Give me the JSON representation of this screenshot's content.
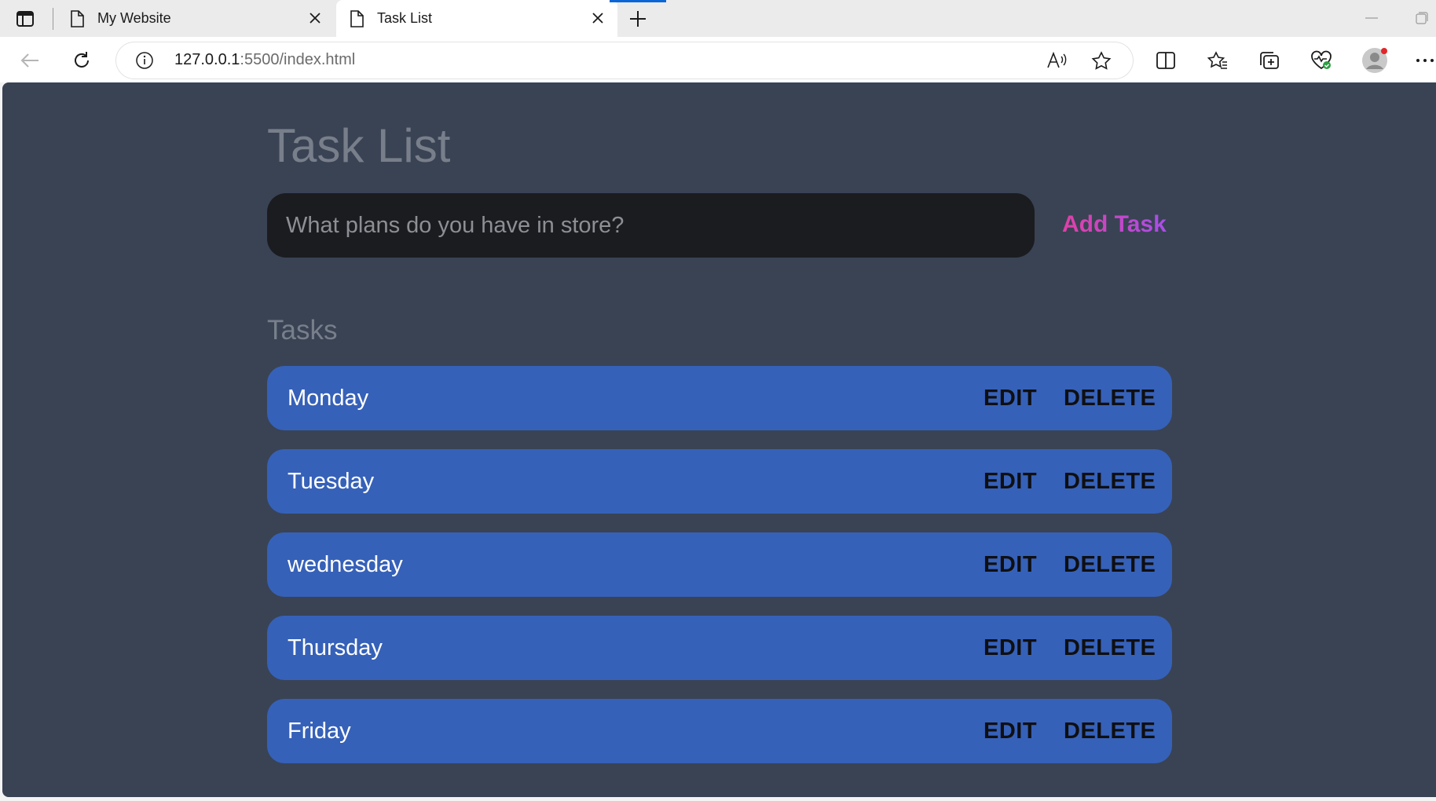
{
  "browser": {
    "tabs": [
      {
        "title": "My Website",
        "active": false
      },
      {
        "title": "Task List",
        "active": true
      }
    ],
    "address": {
      "host": "127.0.0.1",
      "rest": ":5500/index.html"
    },
    "icons": [
      "sidebar-icon",
      "document-icon",
      "close-icon",
      "plus-icon",
      "back-arrow-icon",
      "refresh-icon",
      "info-icon",
      "read-aloud-icon",
      "star-icon",
      "split-screen-icon",
      "favorites-icon",
      "collections-icon",
      "browser-essentials-icon",
      "profile-icon",
      "more-icon",
      "minimize-icon",
      "restore-icon"
    ],
    "accent_color": "#0a66d6"
  },
  "app": {
    "title": "Task List",
    "input_placeholder": "What plans do you have in store?",
    "input_value": "",
    "add_button_label": "Add Task",
    "tasks_heading": "Tasks",
    "tasks": [
      {
        "name": "Monday",
        "edit_label": "EDIT",
        "delete_label": "DELETE"
      },
      {
        "name": "Tuesday",
        "edit_label": "EDIT",
        "delete_label": "DELETE"
      },
      {
        "name": "wednesday",
        "edit_label": "EDIT",
        "delete_label": "DELETE"
      },
      {
        "name": "Thursday",
        "edit_label": "EDIT",
        "delete_label": "DELETE"
      },
      {
        "name": "Friday",
        "edit_label": "EDIT",
        "delete_label": "DELETE"
      }
    ],
    "colors": {
      "background": "#394354",
      "task_row": "#3661b8",
      "input_bg": "#1b1c20",
      "add_gradient_start": "#e040a6",
      "add_gradient_end": "#a94ee8"
    }
  }
}
